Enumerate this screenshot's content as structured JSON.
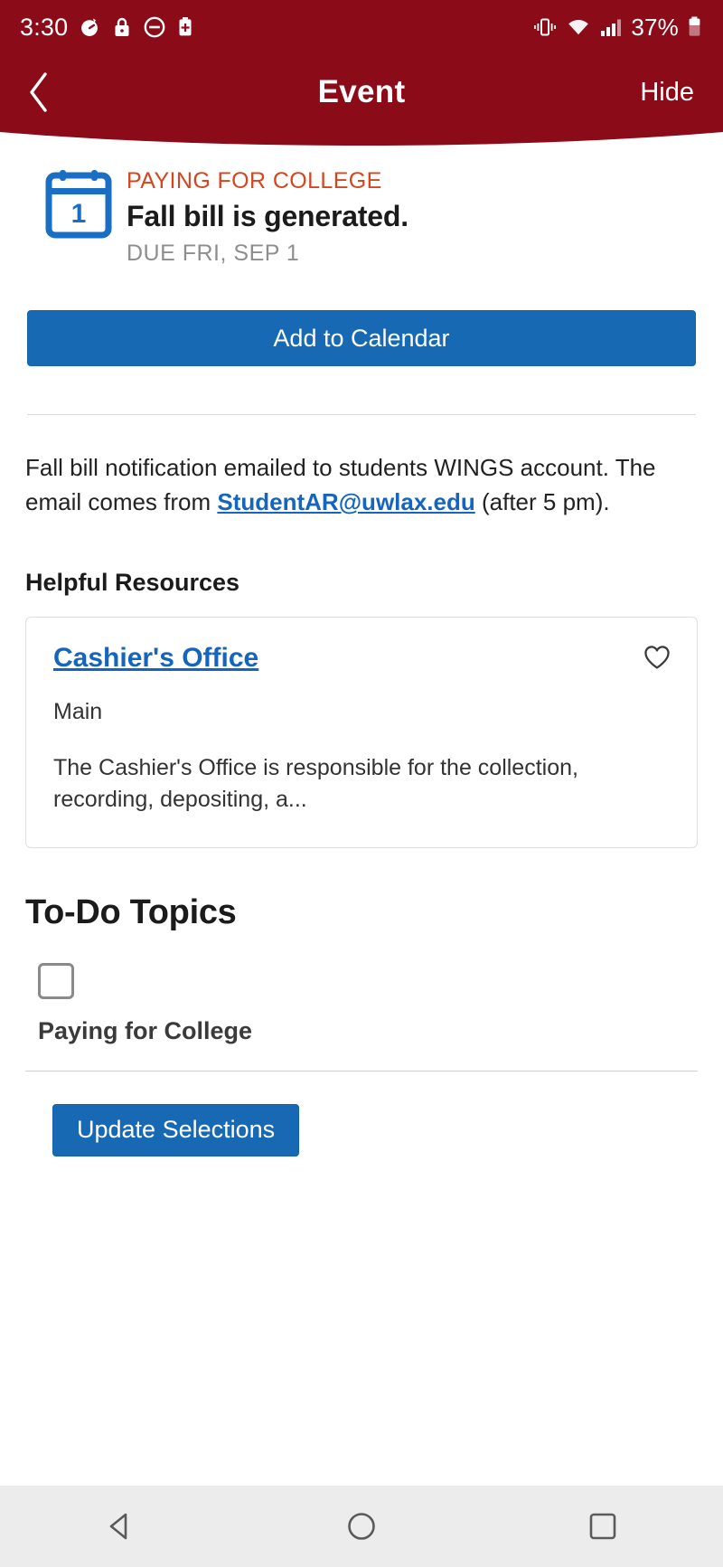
{
  "status_bar": {
    "time": "3:30",
    "battery_percent": "37%",
    "icons": [
      "clock-icon",
      "lock-icon",
      "do-not-disturb-icon",
      "battery-saver-icon",
      "vibrate-icon",
      "wifi-icon",
      "cellular-signal-icon",
      "battery-icon"
    ],
    "background_color": "#8c0b19"
  },
  "app_bar": {
    "back_label": "back-arrow",
    "title": "Event",
    "hide_label": "Hide"
  },
  "event": {
    "calendar_day": "1",
    "kicker": "PAYING FOR COLLEGE",
    "title": "Fall bill is generated.",
    "due": "DUE FRI, SEP 1",
    "add_to_calendar_label": "Add to Calendar",
    "kicker_color": "#d6451f",
    "button_color": "#1769b4"
  },
  "body": {
    "text_before_link": "Fall bill notification emailed to students WINGS account.  The email comes from ",
    "link_text": "StudentAR@uwlax.edu",
    "text_after_link": " (after 5 pm)."
  },
  "helpful_resources": {
    "heading": "Helpful Resources",
    "cards": [
      {
        "link": "Cashier's Office",
        "subtitle": "Main",
        "description": "The Cashier's Office is responsible for the collection, recording, depositing, a...",
        "favorite_icon": "heart-icon"
      }
    ]
  },
  "todo": {
    "heading": "To-Do Topics",
    "items": [
      {
        "label": "Paying for College",
        "checked": false
      }
    ],
    "update_button_label": "Update Selections"
  },
  "nav_bar": {
    "back": "triangle-back-icon",
    "home": "circle-home-icon",
    "recents": "square-recents-icon",
    "background_color": "#ececec"
  }
}
